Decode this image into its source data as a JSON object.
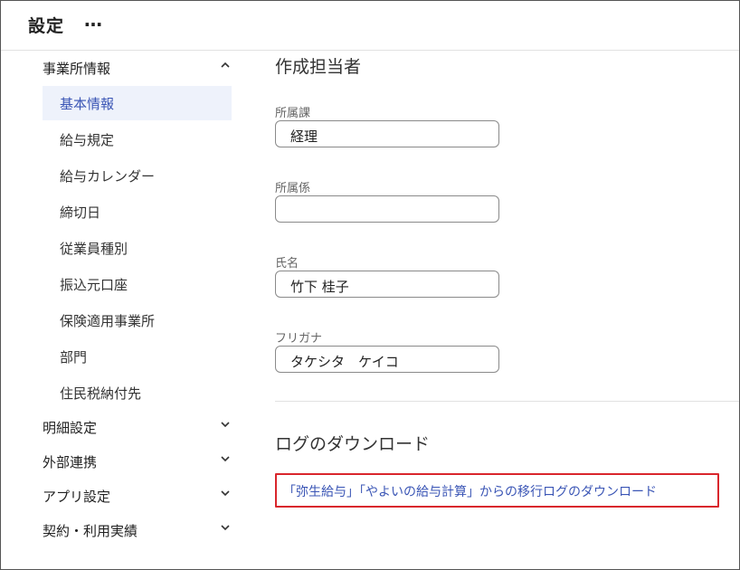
{
  "header": {
    "title": "設定",
    "more_label": "…"
  },
  "sidebar": {
    "sections": [
      {
        "label": "事業所情報",
        "chevron": "^",
        "expanded": true,
        "items": [
          {
            "label": "基本情報",
            "active": true
          },
          {
            "label": "給与規定"
          },
          {
            "label": "給与カレンダー"
          },
          {
            "label": "締切日"
          },
          {
            "label": "従業員種別"
          },
          {
            "label": "振込元口座"
          },
          {
            "label": "保険適用事業所"
          },
          {
            "label": "部門"
          },
          {
            "label": "住民税納付先"
          }
        ]
      },
      {
        "label": "明細設定",
        "chevron": "v"
      },
      {
        "label": "外部連携",
        "chevron": "v"
      },
      {
        "label": "アプリ設定",
        "chevron": "v"
      },
      {
        "label": "契約・利用実績",
        "chevron": "v"
      }
    ]
  },
  "main": {
    "creator_section": {
      "title": "作成担当者",
      "fields": [
        {
          "label": "所属課",
          "value": "経理"
        },
        {
          "label": "所属係",
          "value": ""
        },
        {
          "label": "氏名",
          "value": "竹下 桂子"
        },
        {
          "label": "フリガナ",
          "value": "タケシタ　ケイコ"
        }
      ]
    },
    "log_section": {
      "title": "ログのダウンロード",
      "link": "「弥生給与」「やよいの給与計算」からの移行ログのダウンロード"
    }
  },
  "colors": {
    "accent": "#3a55b5",
    "highlight_border": "#d9262c",
    "active_bg": "#eef2fb"
  }
}
